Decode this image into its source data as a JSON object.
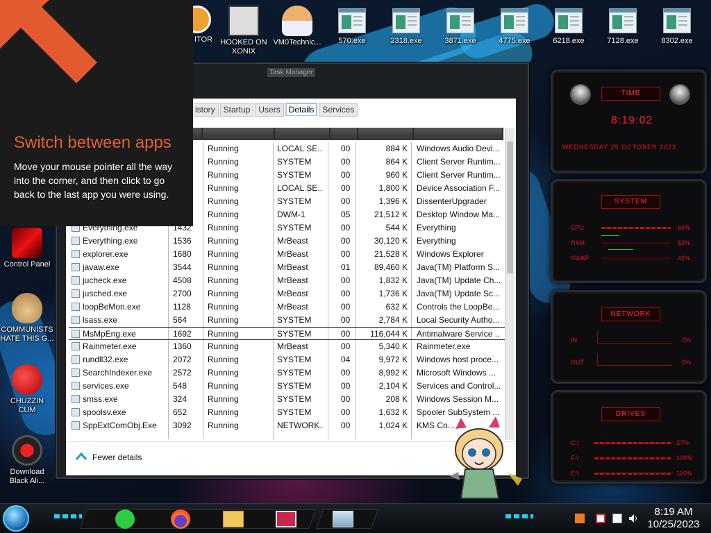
{
  "desktop": {
    "top_icons": [
      {
        "label": "ITOR"
      },
      {
        "label": "HOOKED ON\nXONIX"
      },
      {
        "label": "VM0Technic..."
      },
      {
        "label": "570.exe"
      },
      {
        "label": "2318.exe"
      },
      {
        "label": "3871.exe"
      },
      {
        "label": "4775.exe"
      },
      {
        "label": "6218.exe"
      },
      {
        "label": "7128.exe"
      },
      {
        "label": "8302.exe"
      }
    ],
    "left_icons": [
      {
        "label": "Control Panel"
      },
      {
        "label": "COMMUNISTS\nHATE THIS G..."
      },
      {
        "label": "CHUZZIN\nCUM"
      },
      {
        "label": "Download\nBlack Ali..."
      }
    ]
  },
  "flyout": {
    "title": "Switch between apps",
    "body": "Move your mouse pointer all the way into the corner, and then click to go back to the last app you were using."
  },
  "task_manager": {
    "title": "Task Manager",
    "tabs": [
      {
        "label": "istory"
      },
      {
        "label": "Startup"
      },
      {
        "label": "Users"
      },
      {
        "label": "Details",
        "active": true
      },
      {
        "label": "Services"
      }
    ],
    "rows": [
      {
        "name": "",
        "pid": "",
        "status": "Running",
        "user": "LOCAL SE...",
        "cpu": "00",
        "mem": "884 K",
        "desc": "Windows Audio Devi..."
      },
      {
        "name": "",
        "pid": "",
        "status": "Running",
        "user": "SYSTEM",
        "cpu": "00",
        "mem": "864 K",
        "desc": "Client Server Runtim..."
      },
      {
        "name": "",
        "pid": "",
        "status": "Running",
        "user": "SYSTEM",
        "cpu": "00",
        "mem": "960 K",
        "desc": "Client Server Runtim..."
      },
      {
        "name": "",
        "pid": "",
        "status": "Running",
        "user": "LOCAL SE...",
        "cpu": "00",
        "mem": "1,800 K",
        "desc": "Device Association F..."
      },
      {
        "name": "",
        "pid": "",
        "status": "Running",
        "user": "SYSTEM",
        "cpu": "00",
        "mem": "1,396 K",
        "desc": "DissenterUpgrader"
      },
      {
        "name": "",
        "pid": "",
        "status": "Running",
        "user": "DWM-1",
        "cpu": "05",
        "mem": "21,512 K",
        "desc": "Desktop Window Ma..."
      },
      {
        "name": "Everything.exe",
        "pid": "1432",
        "status": "Running",
        "user": "SYSTEM",
        "cpu": "00",
        "mem": "544 K",
        "desc": "Everything"
      },
      {
        "name": "Everything.exe",
        "pid": "1536",
        "status": "Running",
        "user": "MrBeast",
        "cpu": "00",
        "mem": "30,120 K",
        "desc": "Everything"
      },
      {
        "name": "explorer.exe",
        "pid": "1680",
        "status": "Running",
        "user": "MrBeast",
        "cpu": "00",
        "mem": "21,528 K",
        "desc": "Windows Explorer"
      },
      {
        "name": "javaw.exe",
        "pid": "3544",
        "status": "Running",
        "user": "MrBeast",
        "cpu": "01",
        "mem": "89,460 K",
        "desc": "Java(TM) Platform S..."
      },
      {
        "name": "jucheck.exe",
        "pid": "4508",
        "status": "Running",
        "user": "MrBeast",
        "cpu": "00",
        "mem": "1,832 K",
        "desc": "Java(TM) Update Ch..."
      },
      {
        "name": "jusched.exe",
        "pid": "2700",
        "status": "Running",
        "user": "MrBeast",
        "cpu": "00",
        "mem": "1,736 K",
        "desc": "Java(TM) Update Sc..."
      },
      {
        "name": "loopBeMon.exe",
        "pid": "1128",
        "status": "Running",
        "user": "MrBeast",
        "cpu": "00",
        "mem": "632 K",
        "desc": "Controls the LoopBe..."
      },
      {
        "name": "lsass.exe",
        "pid": "564",
        "status": "Running",
        "user": "SYSTEM",
        "cpu": "00",
        "mem": "2,784 K",
        "desc": "Local Security Autho..."
      },
      {
        "name": "MsMpEng.exe",
        "pid": "1692",
        "status": "Running",
        "user": "SYSTEM",
        "cpu": "00",
        "mem": "116,044 K",
        "desc": "Antimalware Service ...",
        "selected": true
      },
      {
        "name": "Rainmeter.exe",
        "pid": "1360",
        "status": "Running",
        "user": "MrBeast",
        "cpu": "00",
        "mem": "5,340 K",
        "desc": "Rainmeter.exe"
      },
      {
        "name": "rundll32.exe",
        "pid": "2072",
        "status": "Running",
        "user": "SYSTEM",
        "cpu": "04",
        "mem": "9,972 K",
        "desc": "Windows host proce..."
      },
      {
        "name": "SearchIndexer.exe",
        "pid": "2572",
        "status": "Running",
        "user": "SYSTEM",
        "cpu": "00",
        "mem": "8,992 K",
        "desc": "Microsoft Windows ..."
      },
      {
        "name": "services.exe",
        "pid": "548",
        "status": "Running",
        "user": "SYSTEM",
        "cpu": "00",
        "mem": "2,104 K",
        "desc": "Services and Control..."
      },
      {
        "name": "smss.exe",
        "pid": "324",
        "status": "Running",
        "user": "SYSTEM",
        "cpu": "00",
        "mem": "208 K",
        "desc": "Windows Session M..."
      },
      {
        "name": "spoolsv.exe",
        "pid": "652",
        "status": "Running",
        "user": "SYSTEM",
        "cpu": "00",
        "mem": "1,632 K",
        "desc": "Spooler SubSystem ..."
      },
      {
        "name": "SppExtComObj.Exe",
        "pid": "3092",
        "status": "Running",
        "user": "NETWORK...",
        "cpu": "00",
        "mem": "1,024 K",
        "desc": "KMS Co..."
      }
    ],
    "fewer_details": "Fewer details"
  },
  "rainmeter": {
    "time_head": "TIME",
    "time": "8:19:02",
    "date": "WEDNESDAY 25 OCTOBER 2023",
    "system_head": "SYSTEM",
    "cpu_label": "CPU",
    "cpu_value": "66%",
    "ram_label": "RAM",
    "ram_value": "52%",
    "swap_label": "SWAP",
    "swap_value": "42%",
    "network_head": "NETWORK",
    "in_label": "IN",
    "in_value": "0%",
    "out_label": "OUT",
    "out_value": "0%",
    "drives_head": "DRIVES",
    "c_label": "C:\\",
    "c_value": "27%",
    "f_label": "F:\\",
    "f_value": "100%",
    "e_label": "E:\\",
    "e_value": "100%"
  },
  "taskbar": {
    "time": "8:19 AM",
    "date": "10/25/2023",
    "accent": "#22d0f0"
  }
}
